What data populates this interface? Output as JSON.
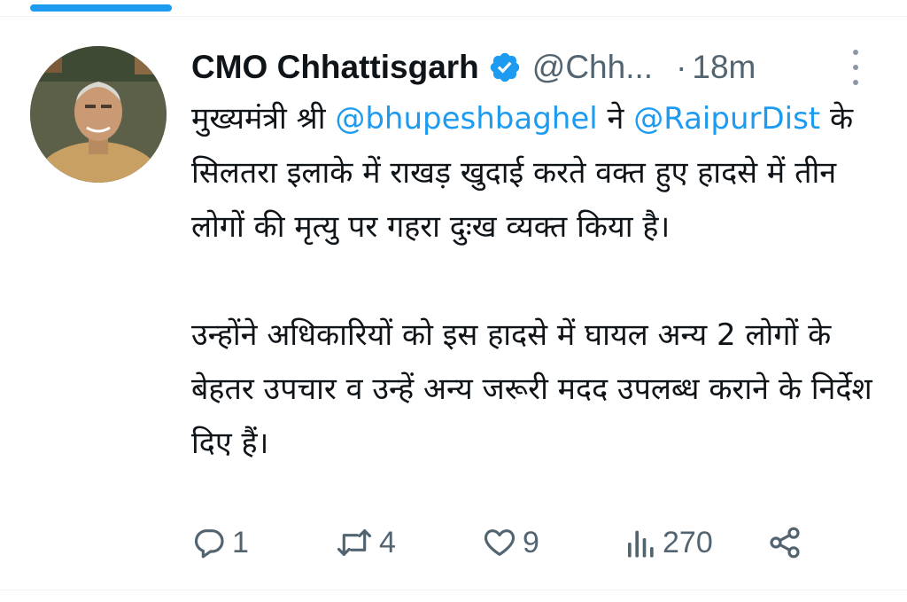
{
  "tweet": {
    "display_name": "CMO Chhattisgarh",
    "handle": "@Chh...",
    "dot_separator": "·",
    "timestamp": "18m",
    "paragraph1": {
      "text_before": "मुख्यमंत्री श्री ",
      "mention1": "@bhupeshbaghel",
      "text_mid1": " ने ",
      "mention2": "@RaipurDist",
      "text_after": " के सिलतरा इलाके में राखड़ खुदाई करते वक्त हुए हादसे में तीन लोगों की मृत्यु पर गहरा दुःख व्यक्त किया है।"
    },
    "paragraph2": "उन्होंने अधिकारियों को इस हादसे में घायल अन्य 2 लोगों के बेहतर  उपचार व उन्हें अन्य जरूरी मदद उपलब्ध कराने के निर्देश दिए हैं।"
  },
  "actions": {
    "reply_count": "1",
    "retweet_count": "4",
    "like_count": "9",
    "views_count": "270"
  },
  "icons": {
    "verified": "verified-badge-icon",
    "more": "more-vertical-icon",
    "reply": "comment-icon",
    "retweet": "retweet-icon",
    "like": "heart-icon",
    "views": "analytics-icon",
    "share": "share-icon"
  },
  "colors": {
    "accent": "#1d9bf0",
    "text": "#0f1419",
    "secondary": "#536471"
  }
}
